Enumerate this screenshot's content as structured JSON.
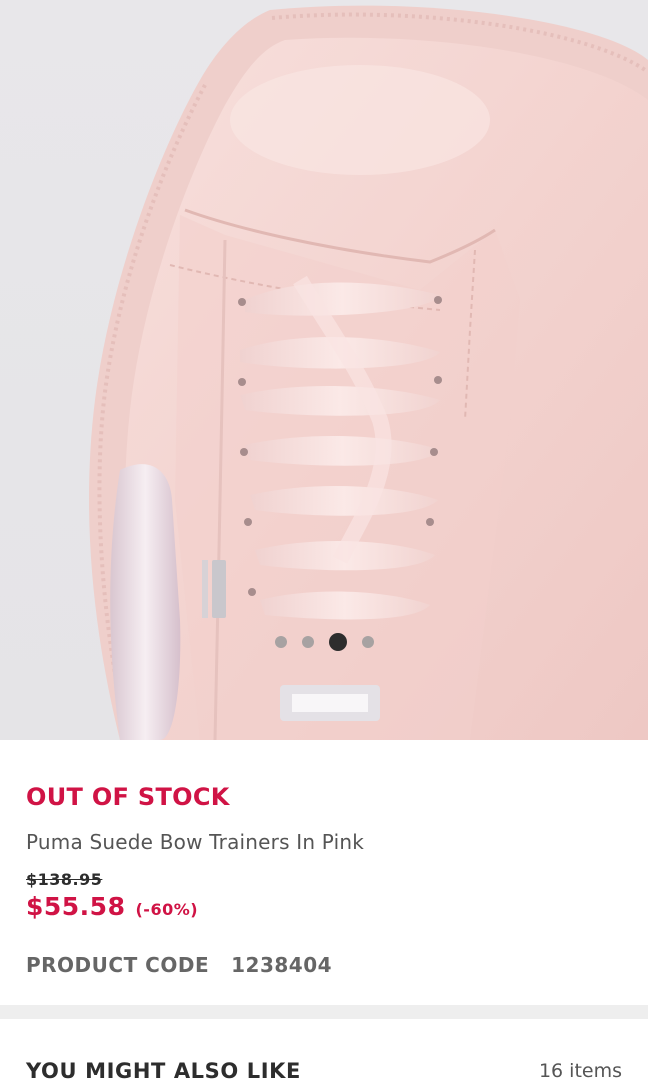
{
  "product_image": {
    "icon": "pink-sneaker-photo",
    "carousel": {
      "count": 4,
      "active_index": 2
    }
  },
  "product": {
    "status": "OUT OF STOCK",
    "name": "Puma Suede Bow Trainers In Pink",
    "original_price": "$138.95",
    "sale_price": "$55.58",
    "discount": "(-60%)",
    "code_label": "PRODUCT CODE",
    "code_value": "1238404"
  },
  "recommendations": {
    "title": "YOU MIGHT ALSO LIKE",
    "count": "16 items"
  },
  "colors": {
    "accent": "#d01345",
    "text_dark": "#2d2d2d",
    "text_muted": "#555555",
    "shoe_pink": "#f4d6d3"
  }
}
